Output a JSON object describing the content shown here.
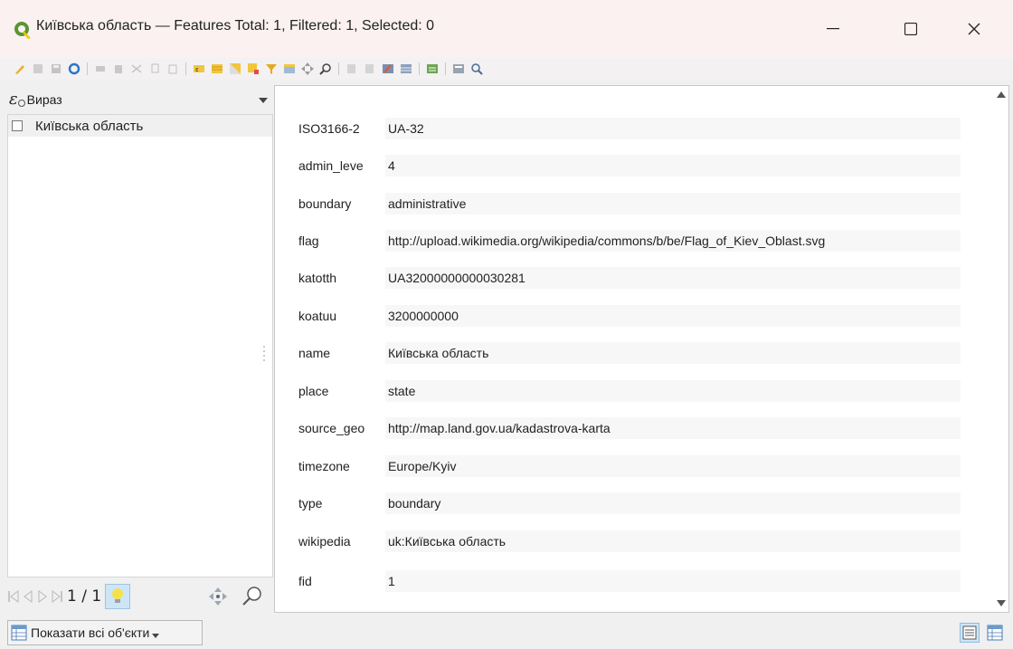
{
  "window": {
    "title": "Київська область — Features Total: 1, Filtered: 1, Selected: 0"
  },
  "left_panel": {
    "expression_label": "Вираз",
    "features": [
      {
        "label": "Київська область",
        "checked": false
      }
    ],
    "pager": "1 / 1"
  },
  "form": {
    "fields": [
      {
        "label": "ISO3166-2",
        "value": "UA-32"
      },
      {
        "label": "admin_leve",
        "value": "4"
      },
      {
        "label": "boundary",
        "value": "administrative"
      },
      {
        "label": "flag",
        "value": "http://upload.wikimedia.org/wikipedia/commons/b/be/Flag_of_Kiev_Oblast.svg"
      },
      {
        "label": "katotth",
        "value": "UA32000000000030281"
      },
      {
        "label": "koatuu",
        "value": "3200000000"
      },
      {
        "label": "name",
        "value": "Київська область"
      },
      {
        "label": "place",
        "value": "state"
      },
      {
        "label": "source_geo",
        "value": "http://map.land.gov.ua/kadastrova-karta"
      },
      {
        "label": "timezone",
        "value": "Europe/Kyiv"
      },
      {
        "label": "type",
        "value": "boundary"
      },
      {
        "label": "wikipedia",
        "value": "uk:Київська область"
      },
      {
        "label": "fid",
        "value": "1"
      }
    ]
  },
  "bottom": {
    "show_all_label": "Показати всі об'єкти"
  },
  "icons": {
    "app": "qgis-icon",
    "minimize": "minimize-icon",
    "maximize": "maximize-icon",
    "close": "close-icon"
  },
  "colors": {
    "titlebar": "#fbf1f1",
    "accent": "#cde6f7",
    "qgis_green": "#589632",
    "qgis_yellow": "#eec90d"
  }
}
